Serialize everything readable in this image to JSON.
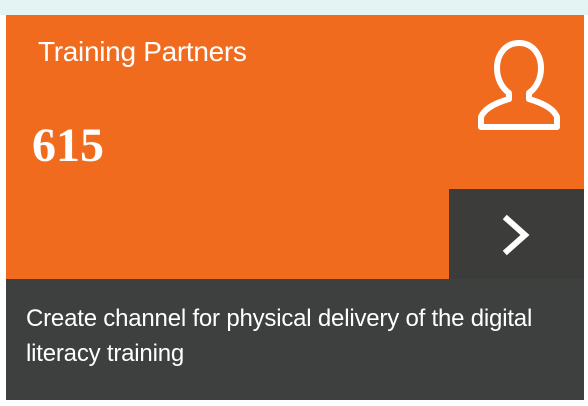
{
  "card": {
    "title": "Training Partners",
    "count": "615",
    "description": "Create channel for physical delivery of the digital literacy training",
    "icon": "user-icon",
    "action_icon": "chevron-right-icon"
  },
  "colors": {
    "accent": "#f16b1f",
    "footer": "#3e3f3f",
    "button": "#3c3c3b",
    "top_strip": "#e4f3f3",
    "text": "#ffffff"
  }
}
